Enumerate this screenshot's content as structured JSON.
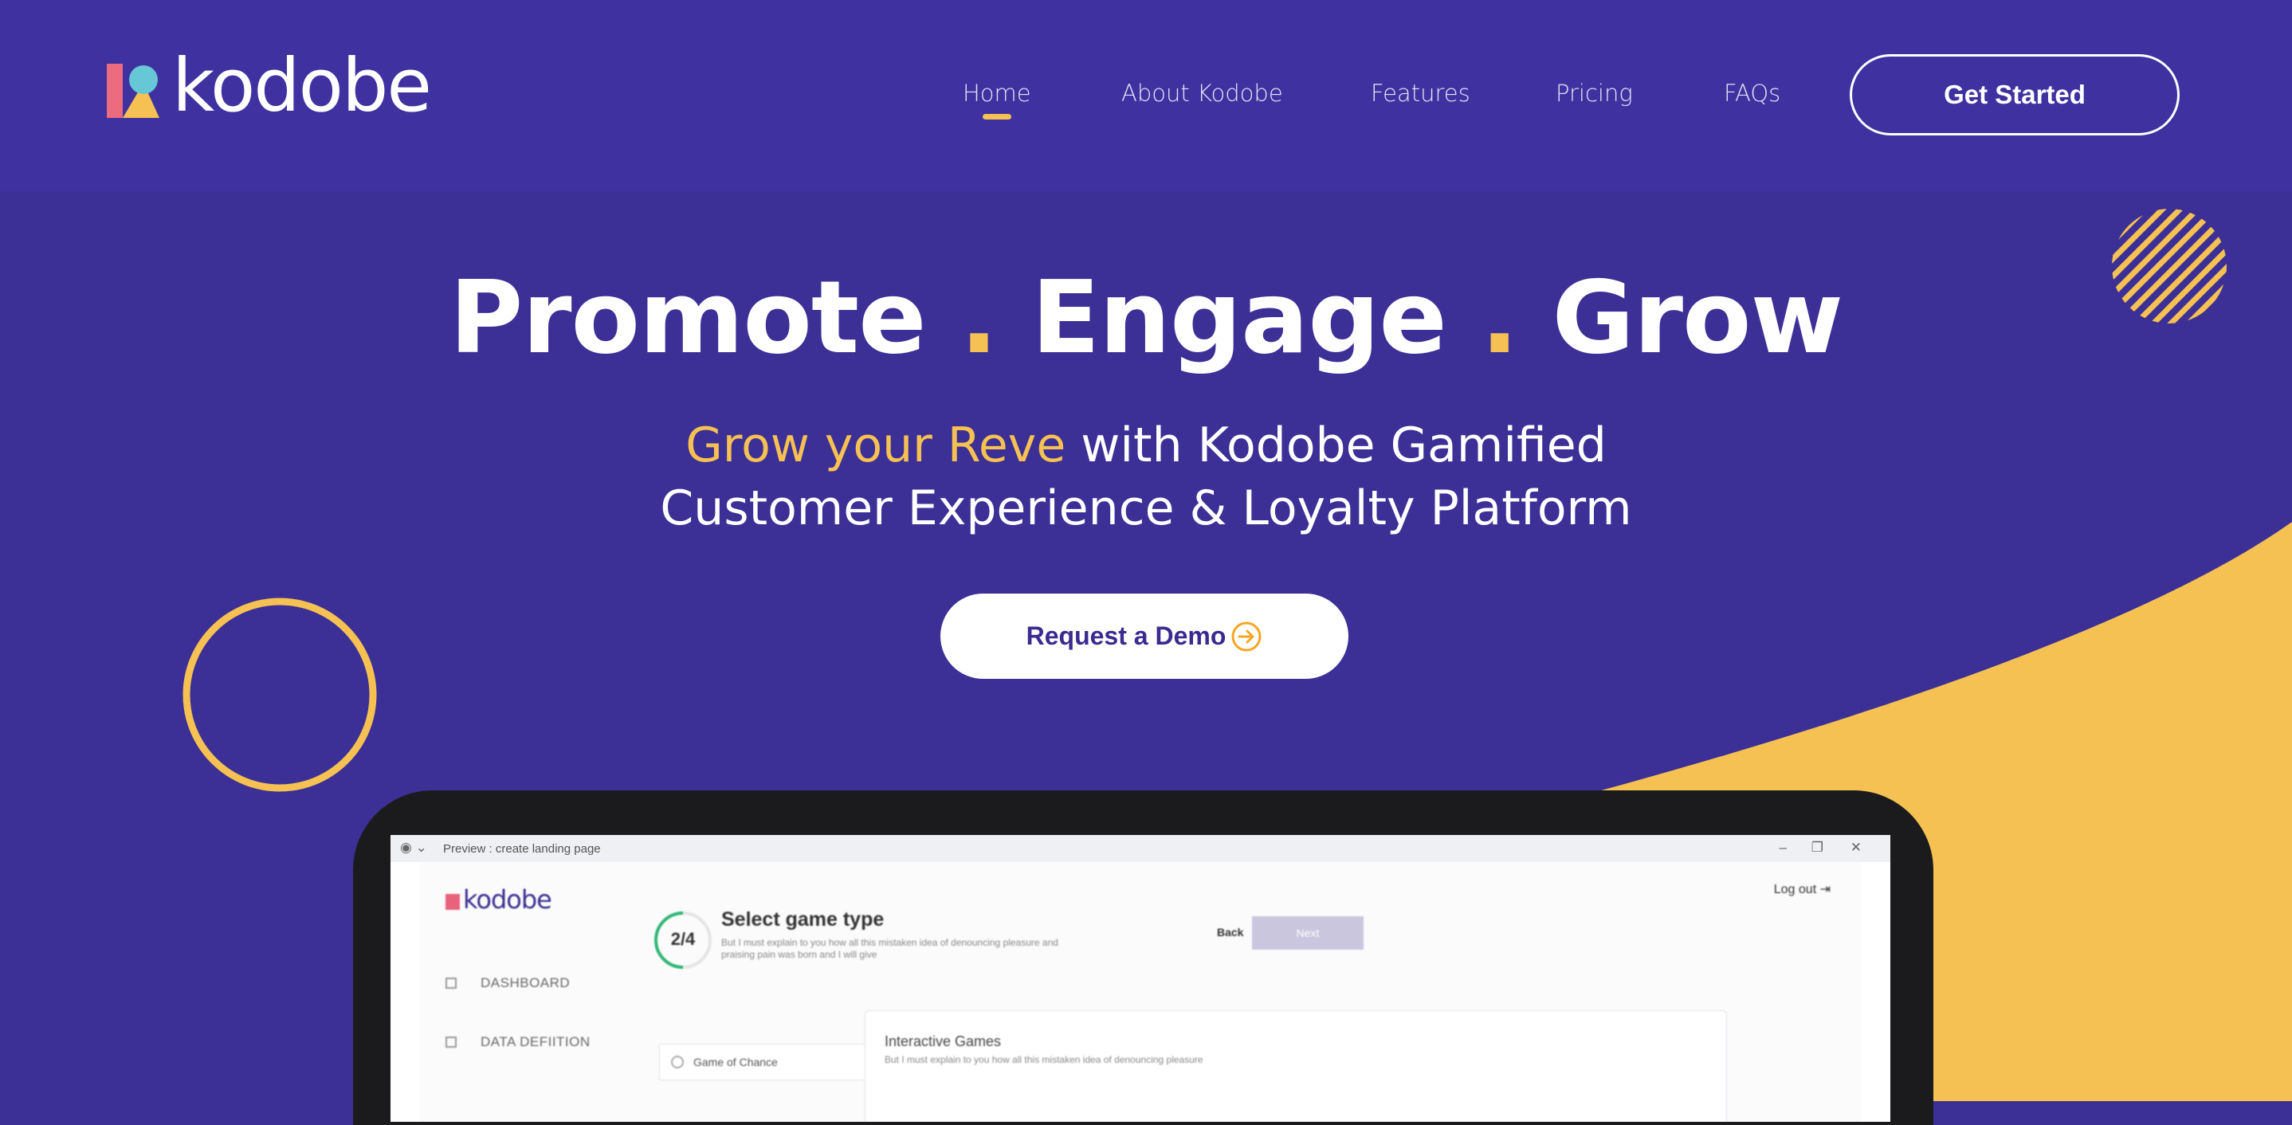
{
  "brand": {
    "name": "kodobe"
  },
  "nav": {
    "links": [
      {
        "label": "Home",
        "active": true
      },
      {
        "label": "About Kodobe"
      },
      {
        "label": "Features"
      },
      {
        "label": "Pricing"
      },
      {
        "label": "FAQs"
      }
    ],
    "cta_label": "Get Started"
  },
  "hero": {
    "title_words": [
      "Promote",
      "Engage",
      "Grow"
    ],
    "title_sep": ".",
    "subtitle_accent": "Grow your Reve",
    "subtitle_line1_rest": " with Kodobe Gamified",
    "subtitle_line2": "Customer Experience & Loyalty Platform",
    "demo_label": "Request a Demo"
  },
  "mockup": {
    "window_title": "Preview : create landing page",
    "app_logo": "kodobe",
    "logout_label": "Log out",
    "step": "2/4",
    "step_title": "Select game type",
    "step_desc": "But I must explain to you how all this mistaken idea of denouncing pleasure and praising pain was born and I will give",
    "back_label": "Back",
    "next_label": "Next",
    "sidebar": [
      "DASHBOARD",
      "DATA DEFIITION"
    ],
    "option_label": "Game of Chance",
    "card_title": "Interactive Games",
    "card_desc": "But I must explain to you how all this mistaken idea of denouncing pleasure"
  },
  "colors": {
    "primary": "#3c2f96",
    "nav": "#3f32a0",
    "accent": "#f5c152",
    "white": "#ffffff",
    "text_dark": "#3b2a8f"
  },
  "icons": [
    "logo-mark-icon",
    "arrow-right-circle-icon",
    "striped-circle-decoration",
    "ring-decoration"
  ]
}
